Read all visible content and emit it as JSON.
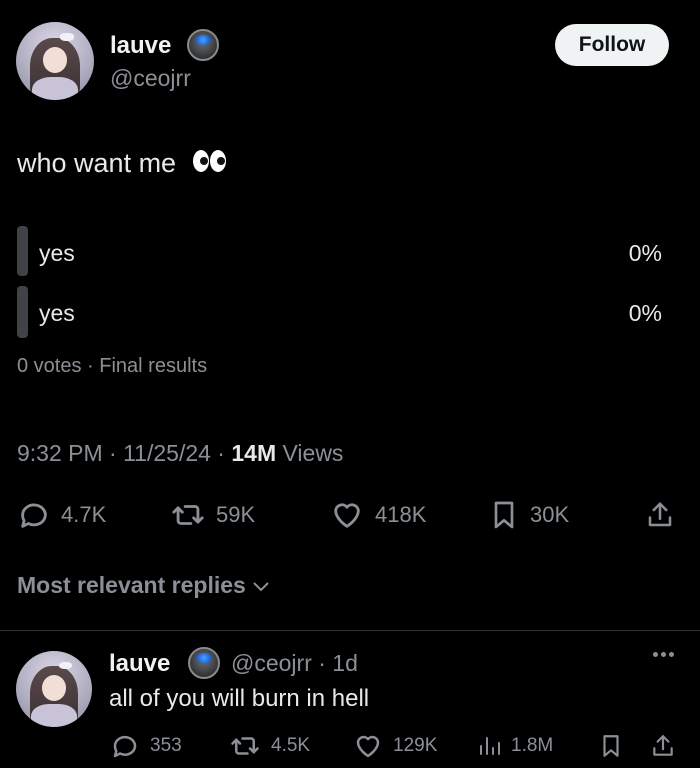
{
  "post": {
    "author_name": "lauve",
    "author_handle": "@ceojrr",
    "follow_label": "Follow",
    "text": "who want me",
    "poll": {
      "options": [
        {
          "label": "yes",
          "percent": "0%"
        },
        {
          "label": "yes",
          "percent": "0%"
        }
      ],
      "meta": "0 votes · Final results"
    },
    "timestamp": "9:32 PM · 11/25/24 · ",
    "views_count": "14M",
    "views_label": " Views",
    "stats": {
      "replies": "4.7K",
      "reposts": "59K",
      "likes": "418K",
      "bookmarks": "30K"
    }
  },
  "replies_header": "Most relevant replies",
  "reply": {
    "author_name": "lauve",
    "author_handle_time": "@ceojrr · 1d",
    "text": "all of you will burn in hell",
    "stats": {
      "replies": "353",
      "reposts": "4.5K",
      "likes": "129K",
      "views": "1.8M"
    }
  },
  "colors": {
    "background": "#000000",
    "text": "#e7e9ea",
    "muted": "#8b9096",
    "poll_bar": "#3f4347"
  },
  "icons": [
    "reply-icon",
    "repost-icon",
    "like-icon",
    "bookmark-icon",
    "share-icon",
    "views-icon",
    "more-icon",
    "chevron-down-icon",
    "verified-badge-icon",
    "eyes-emoji"
  ]
}
